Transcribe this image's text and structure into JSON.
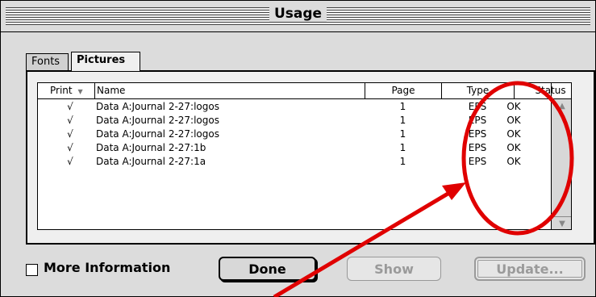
{
  "window": {
    "title": "Usage"
  },
  "tabs": [
    {
      "label": "Fonts"
    },
    {
      "label": "Pictures"
    }
  ],
  "list": {
    "columns": [
      "Print",
      "Name",
      "Page",
      "Type",
      "Status"
    ],
    "rows": [
      {
        "print": "√",
        "name": "Data A:Journal 2-27:logos",
        "page": "1",
        "type": "EPS",
        "status": "OK"
      },
      {
        "print": "√",
        "name": "Data A:Journal 2-27:logos",
        "page": "1",
        "type": "EPS",
        "status": "OK"
      },
      {
        "print": "√",
        "name": "Data A:Journal 2-27:logos",
        "page": "1",
        "type": "EPS",
        "status": "OK"
      },
      {
        "print": "√",
        "name": "Data A:Journal 2-27:1b",
        "page": "1",
        "type": "EPS",
        "status": "OK"
      },
      {
        "print": "√",
        "name": "Data A:Journal 2-27:1a",
        "page": "1",
        "type": "EPS",
        "status": "OK"
      }
    ]
  },
  "footer": {
    "more_info_label": "More Information",
    "done_label": "Done",
    "show_label": "Show",
    "update_label": "Update..."
  },
  "icons": {
    "sort": "sort-triangle-icon",
    "scroll_up": "scroll-up-arrow-icon",
    "scroll_down": "scroll-down-arrow-icon"
  },
  "colors": {
    "annotation": "#e00000"
  }
}
